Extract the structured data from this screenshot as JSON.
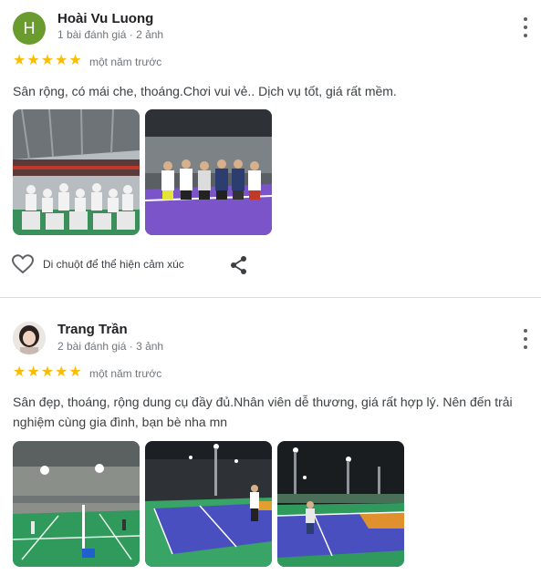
{
  "reviews": [
    {
      "author": "Hoài Vu Luong",
      "avatar_letter": "H",
      "meta": "1 bài đánh giá · 2 ảnh",
      "rating": 5,
      "when": "một năm trước",
      "text": "Sân rộng, có mái che, thoáng.Chơi vui vẻ.. Dịch vụ tốt, giá rất mềm.",
      "photo_count": 2,
      "reaction_label": "Di chuột để thể hiện cảm xúc"
    },
    {
      "author": "Trang Trần",
      "meta": "2 bài đánh giá · 3 ảnh",
      "rating": 5,
      "when": "một năm trước",
      "text": "Sân đẹp, thoáng, rộng dung cụ đầy đủ.Nhân viên dễ thương, giá rất hợp lý. Nên đến trải nghiệm cùng gia đình, bạn bè nha mn",
      "photo_count": 3
    }
  ],
  "icons": {
    "star": "star-icon",
    "menu": "more-vert-icon",
    "heart": "heart-outline-icon",
    "share": "share-icon"
  },
  "colors": {
    "star": "#fbbc04",
    "avatar_bg": "#6a9b2f",
    "court_blue": "#4a4fc0",
    "court_green": "#2f8f55"
  }
}
